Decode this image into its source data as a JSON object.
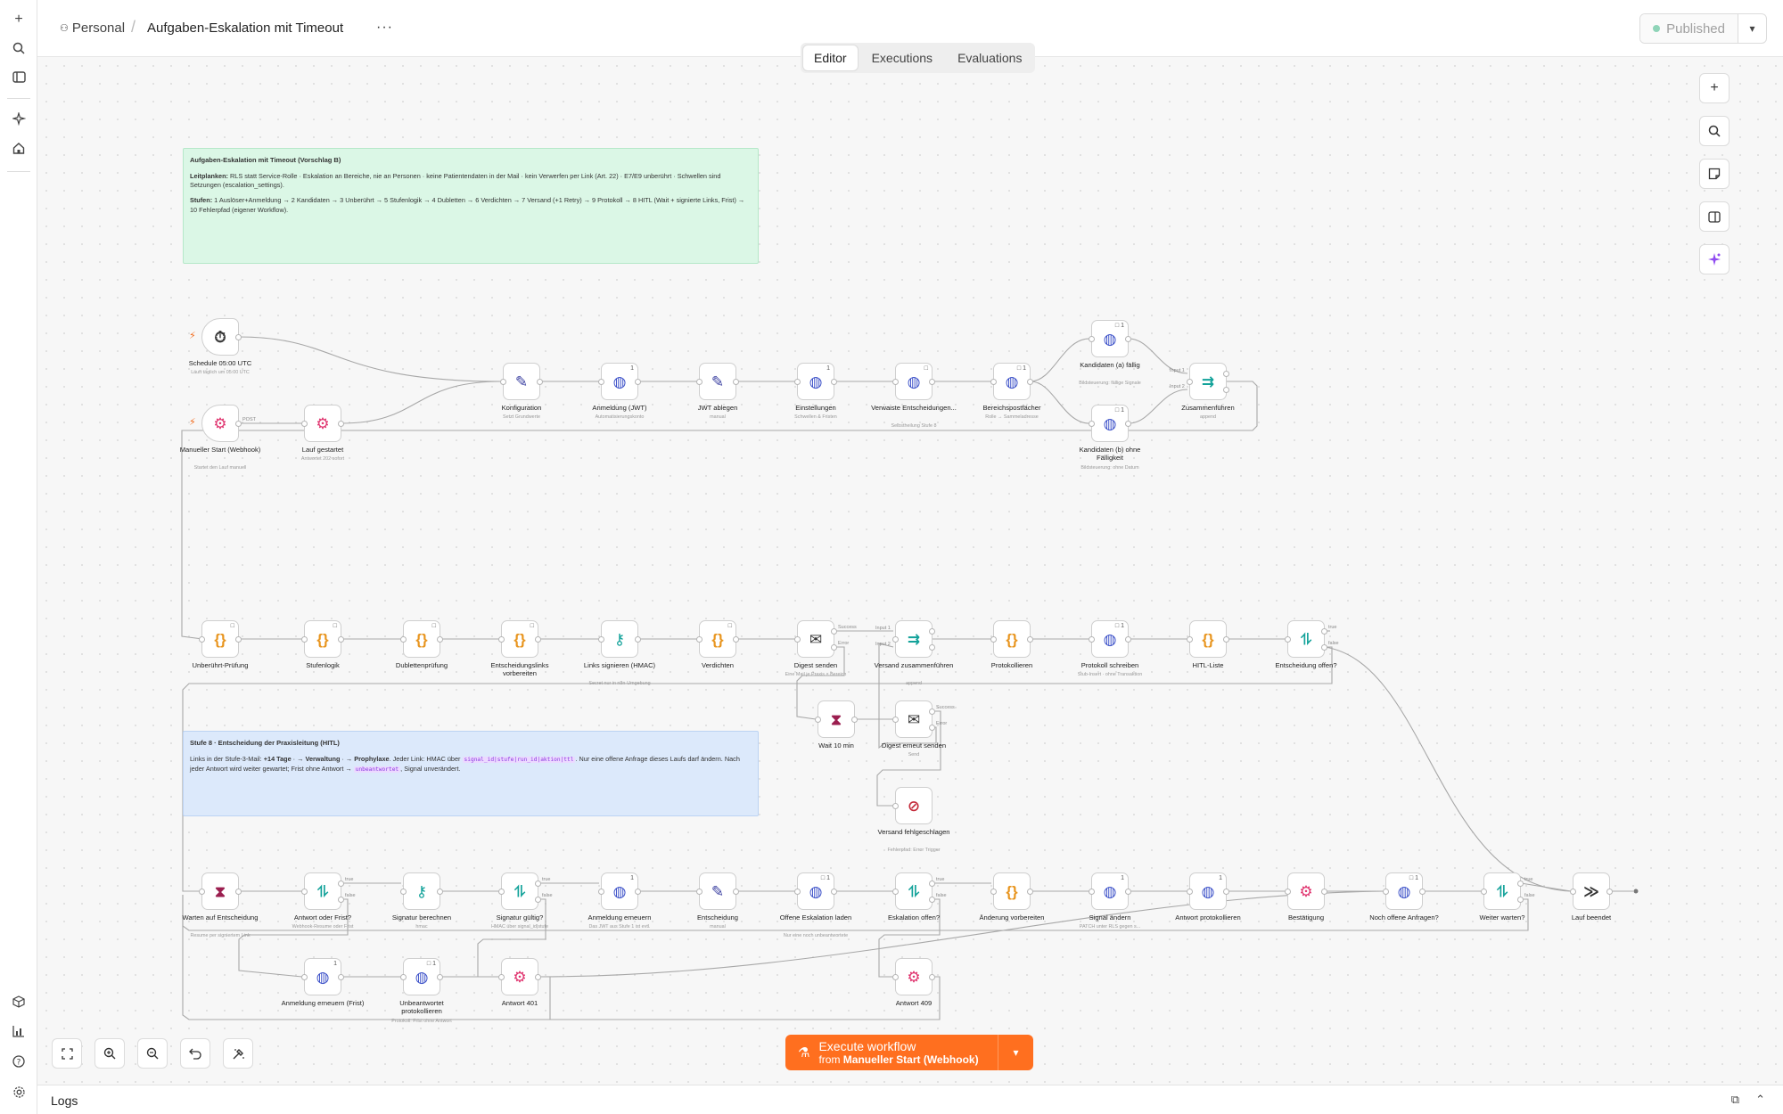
{
  "sidebar": {
    "icons": [
      "plus-icon",
      "search-icon",
      "sidebar-toggle-icon",
      "sparkle-icon",
      "home-icon",
      "cube-icon",
      "chart-icon",
      "help-icon",
      "settings-icon"
    ]
  },
  "header": {
    "breadcrumb_home": "Personal",
    "breadcrumb_separator": "/",
    "title": "Aufgaben-Eskalation mit Timeout",
    "more": "···",
    "publish_label": "Published",
    "publish_status_color": "#8fd4b8"
  },
  "tabs": [
    {
      "label": "Editor",
      "active": true
    },
    {
      "label": "Executions",
      "active": false
    },
    {
      "label": "Evaluations",
      "active": false
    }
  ],
  "stickies": {
    "top": {
      "title": "Aufgaben-Eskalation mit Timeout (Vorschlag B)",
      "p1_bold": "Leitplanken:",
      "p1": "RLS statt Service-Rolle · Eskalation an Bereiche, nie an Personen · keine Patientendaten in der Mail · kein Verwerfen per Link (Art. 22) · E7/E9 unberührt · Schwellen sind Setzungen (escalation_settings).",
      "p2_bold": "Stufen:",
      "p2": "1 Auslöser+Anmeldung → 2 Kandidaten → 3 Unberührt → 5 Stufenlogik → 4 Dubletten → 6 Verdichten → 7 Versand (+1 Retry) → 9 Protokoll → 8 HITL (Wait + signierte Links, Frist) → 10 Fehlerpfad (eigener Workflow)."
    },
    "hitl": {
      "title": "Stufe 8 · Entscheidung der Praxisleitung (HITL)",
      "t1": "Links in der Stufe-3-Mail:",
      "t1b": "+14 Tage",
      "t2": " · ",
      "t2b": "→ Verwaltung",
      "t3": " · ",
      "t3b": "→ Prophylaxe",
      "t4": ". Jeder Link: HMAC über",
      "code1": "signal_id|stufe|run_id|aktion|ttl",
      "t5": ". Nur eine offene Anfrage dieses Laufs darf ändern. Nach jeder Antwort wird weiter gewartet; Frist ohne Antwort →",
      "code2": "unbeantwortet",
      "t6": ", Signal unverändert."
    }
  },
  "nodes": [
    {
      "id": "schedule",
      "label": "Schedule 05:00 UTC",
      "sub": "Läuft täglich um 05:00 UTC",
      "icon": "⏱",
      "color": "c-dark",
      "trigger": true
    },
    {
      "id": "webhook-start",
      "label": "Manueller Start (Webhook)",
      "sub": "Startet den Lauf manuell",
      "icon": "⚙",
      "color": "c-pink",
      "trigger": true,
      "tag": "POST"
    },
    {
      "id": "lauf-gestartet",
      "label": "Lauf gestartet",
      "sub": "Antwortet 202 sofort",
      "icon": "⚙",
      "color": "c-pink"
    },
    {
      "id": "konfiguration",
      "label": "Konfiguration",
      "sub": "Setzt Grundwerte",
      "icon": "✎",
      "color": "c-purple"
    },
    {
      "id": "anmeldung-jwt",
      "label": "Anmeldung (JWT)",
      "sub": "Automatisierungskonto",
      "icon": "◍",
      "color": "c-blue",
      "badge": "1"
    },
    {
      "id": "jwt-ablegen",
      "label": "JWT ablegen",
      "sub": "manual",
      "icon": "✎",
      "color": "c-purple"
    },
    {
      "id": "einstellungen",
      "label": "Einstellungen",
      "sub": "Schwellen & Fristen",
      "icon": "◍",
      "color": "c-blue",
      "badge": "1"
    },
    {
      "id": "verwaiste",
      "label": "Verwaiste Entscheidungen...",
      "sub": "Selbstheilung Stufe 8",
      "icon": "◍",
      "color": "c-blue",
      "badge": "□"
    },
    {
      "id": "bereichspostfaecher",
      "label": "Bereichspostfächer",
      "sub": "Rolle → Sammeladresse",
      "icon": "◍",
      "color": "c-blue",
      "badge": "□ 1"
    },
    {
      "id": "kandidaten-a",
      "label": "Kandidaten (a) fällig",
      "sub": "Bildsteuerung: fällige Signale",
      "icon": "◍",
      "color": "c-blue",
      "badge": "□ 1"
    },
    {
      "id": "kandidaten-b",
      "label": "Kandidaten (b) ohne Fälligkeit",
      "sub": "Bildsteuerung: ohne Datum",
      "icon": "◍",
      "color": "c-blue",
      "badge": "□ 1"
    },
    {
      "id": "zusammen-1",
      "label": "Zusammenführen",
      "sub": "append",
      "icon": "⇉",
      "color": "c-teal",
      "tags": [
        "Input 1",
        "Input 2"
      ]
    },
    {
      "id": "unberuehrt",
      "label": "Unberührt-Prüfung",
      "sub": "",
      "icon": "{}",
      "color": "c-orange",
      "badge": "□"
    },
    {
      "id": "stufenlogik",
      "label": "Stufenlogik",
      "sub": "",
      "icon": "{}",
      "color": "c-orange",
      "badge": "□"
    },
    {
      "id": "dubletten",
      "label": "Dublettenprüfung",
      "sub": "",
      "icon": "{}",
      "color": "c-orange",
      "badge": "□"
    },
    {
      "id": "entscheidungslinks",
      "label": "Entscheidungslinks vorbereiten",
      "sub": "",
      "icon": "{}",
      "color": "c-orange",
      "badge": "□"
    },
    {
      "id": "links-signieren",
      "label": "Links signieren (HMAC)",
      "sub": "Secret nur in n8n-Umgebung",
      "icon": "⚷",
      "color": "c-teal"
    },
    {
      "id": "verdichten",
      "label": "Verdichten",
      "sub": "",
      "icon": "{}",
      "color": "c-orange",
      "badge": "□"
    },
    {
      "id": "digest-senden",
      "label": "Digest senden",
      "sub": "Eine Mail je Praxis × Bereich",
      "icon": "✉",
      "color": "c-dark",
      "tags": [
        "Success",
        "Error"
      ]
    },
    {
      "id": "versand-zusammen",
      "label": "Versand zusammenführen",
      "sub": "append",
      "icon": "⇉",
      "color": "c-teal",
      "tags": [
        "Input 1",
        "Input 2"
      ]
    },
    {
      "id": "protokollieren",
      "label": "Protokollieren",
      "sub": "",
      "icon": "{}",
      "color": "c-orange"
    },
    {
      "id": "protokoll-schreiben",
      "label": "Protokoll schreiben",
      "sub": "Stub-Insert · ohne Transaktion",
      "icon": "◍",
      "color": "c-blue",
      "badge": "□ 1"
    },
    {
      "id": "hitl-liste",
      "label": "HITL-Liste",
      "sub": "",
      "icon": "{}",
      "color": "c-orange"
    },
    {
      "id": "entscheidung-offen",
      "label": "Entscheidung offen?",
      "sub": "",
      "icon": "⥮",
      "color": "c-teal",
      "tags": [
        "true",
        "false"
      ]
    },
    {
      "id": "wait-10",
      "label": "Wait 10 min",
      "sub": "",
      "icon": "⧗",
      "color": "c-maroon"
    },
    {
      "id": "digest-erneut",
      "label": "Digest erneut senden",
      "sub": "Send",
      "icon": "✉",
      "color": "c-dark",
      "tags": [
        "Success",
        "Error"
      ]
    },
    {
      "id": "versand-fehl",
      "label": "Versand fehlgeschlagen",
      "sub": "Fehlerpfad: Error Trigger",
      "icon": "⊘",
      "color": "c-red"
    },
    {
      "id": "warten",
      "label": "Warten auf Entscheidung",
      "sub": "Resume per signiertem Link",
      "icon": "⧗",
      "color": "c-maroon"
    },
    {
      "id": "antwort-frist",
      "label": "Antwort oder Frist?",
      "sub": "Webhook-Resume oder Frist",
      "icon": "⥮",
      "color": "c-teal",
      "tags": [
        "true",
        "false"
      ]
    },
    {
      "id": "signatur-berechnen",
      "label": "Signatur berechnen",
      "sub": "hmac",
      "icon": "⚷",
      "color": "c-teal"
    },
    {
      "id": "signatur-gueltig",
      "label": "Signatur gültig?",
      "sub": "HMAC über signal_id|stufe",
      "icon": "⥮",
      "color": "c-teal",
      "tags": [
        "true",
        "false"
      ]
    },
    {
      "id": "anmeldung-erneuern",
      "label": "Anmeldung erneuern",
      "sub": "Das JWT aus Stufe 1 ist evtl.",
      "icon": "◍",
      "color": "c-blue",
      "badge": "1"
    },
    {
      "id": "entscheidung",
      "label": "Entscheidung",
      "sub": "manual",
      "icon": "✎",
      "color": "c-purple"
    },
    {
      "id": "offene-eskalation",
      "label": "Offene Eskalation laden",
      "sub": "Nur eine noch unbeantwortete",
      "icon": "◍",
      "color": "c-blue",
      "badge": "□ 1"
    },
    {
      "id": "eskalation-offen",
      "label": "Eskalation offen?",
      "sub": "",
      "icon": "⥮",
      "color": "c-teal",
      "tags": [
        "true",
        "false"
      ]
    },
    {
      "id": "aenderung",
      "label": "Änderung vorbereiten",
      "sub": "",
      "icon": "{}",
      "color": "c-orange"
    },
    {
      "id": "signal-aendern",
      "label": "Signal ändern",
      "sub": "PATCH unter RLS gegen s...",
      "icon": "◍",
      "color": "c-blue",
      "badge": "1"
    },
    {
      "id": "antwort-protokoll",
      "label": "Antwort protokollieren",
      "sub": "",
      "icon": "◍",
      "color": "c-blue",
      "badge": "1"
    },
    {
      "id": "bestaetigung",
      "label": "Bestätigung",
      "sub": "",
      "icon": "⚙",
      "color": "c-pink"
    },
    {
      "id": "noch-offene",
      "label": "Noch offene Anfragen?",
      "sub": "",
      "icon": "◍",
      "color": "c-blue",
      "badge": "□ 1"
    },
    {
      "id": "weiter-warten",
      "label": "Weiter warten?",
      "sub": "",
      "icon": "⥮",
      "color": "c-teal",
      "tags": [
        "true",
        "false"
      ]
    },
    {
      "id": "lauf-beendet",
      "label": "Lauf beendet",
      "sub": "",
      "icon": "≫",
      "color": "c-dark"
    },
    {
      "id": "anmeldung-frist",
      "label": "Anmeldung erneuern (Frist)",
      "sub": "",
      "icon": "◍",
      "color": "c-blue",
      "badge": "1"
    },
    {
      "id": "unbeantwortet",
      "label": "Unbeantwortet protokollieren",
      "sub": "Protokoll: Frist ohne Antwort",
      "icon": "◍",
      "color": "c-blue",
      "badge": "□ 1"
    },
    {
      "id": "antwort-401",
      "label": "Antwort 401",
      "sub": "",
      "icon": "⚙",
      "color": "c-pink"
    },
    {
      "id": "antwort-409",
      "label": "Antwort 409",
      "sub": "",
      "icon": "⚙",
      "color": "c-pink"
    }
  ],
  "right_toolbar": [
    "plus-icon",
    "search-icon",
    "sticky-note-icon",
    "panel-icon",
    "sparkle-icon"
  ],
  "controls": [
    "fit-view-icon",
    "zoom-in-icon",
    "zoom-out-icon",
    "undo-icon",
    "tidy-up-icon"
  ],
  "execute": {
    "label": "Execute workflow",
    "from_prefix": "from",
    "from_node": "Manueller Start (Webhook)",
    "color": "#ff6f1f"
  },
  "logs": {
    "title": "Logs"
  }
}
